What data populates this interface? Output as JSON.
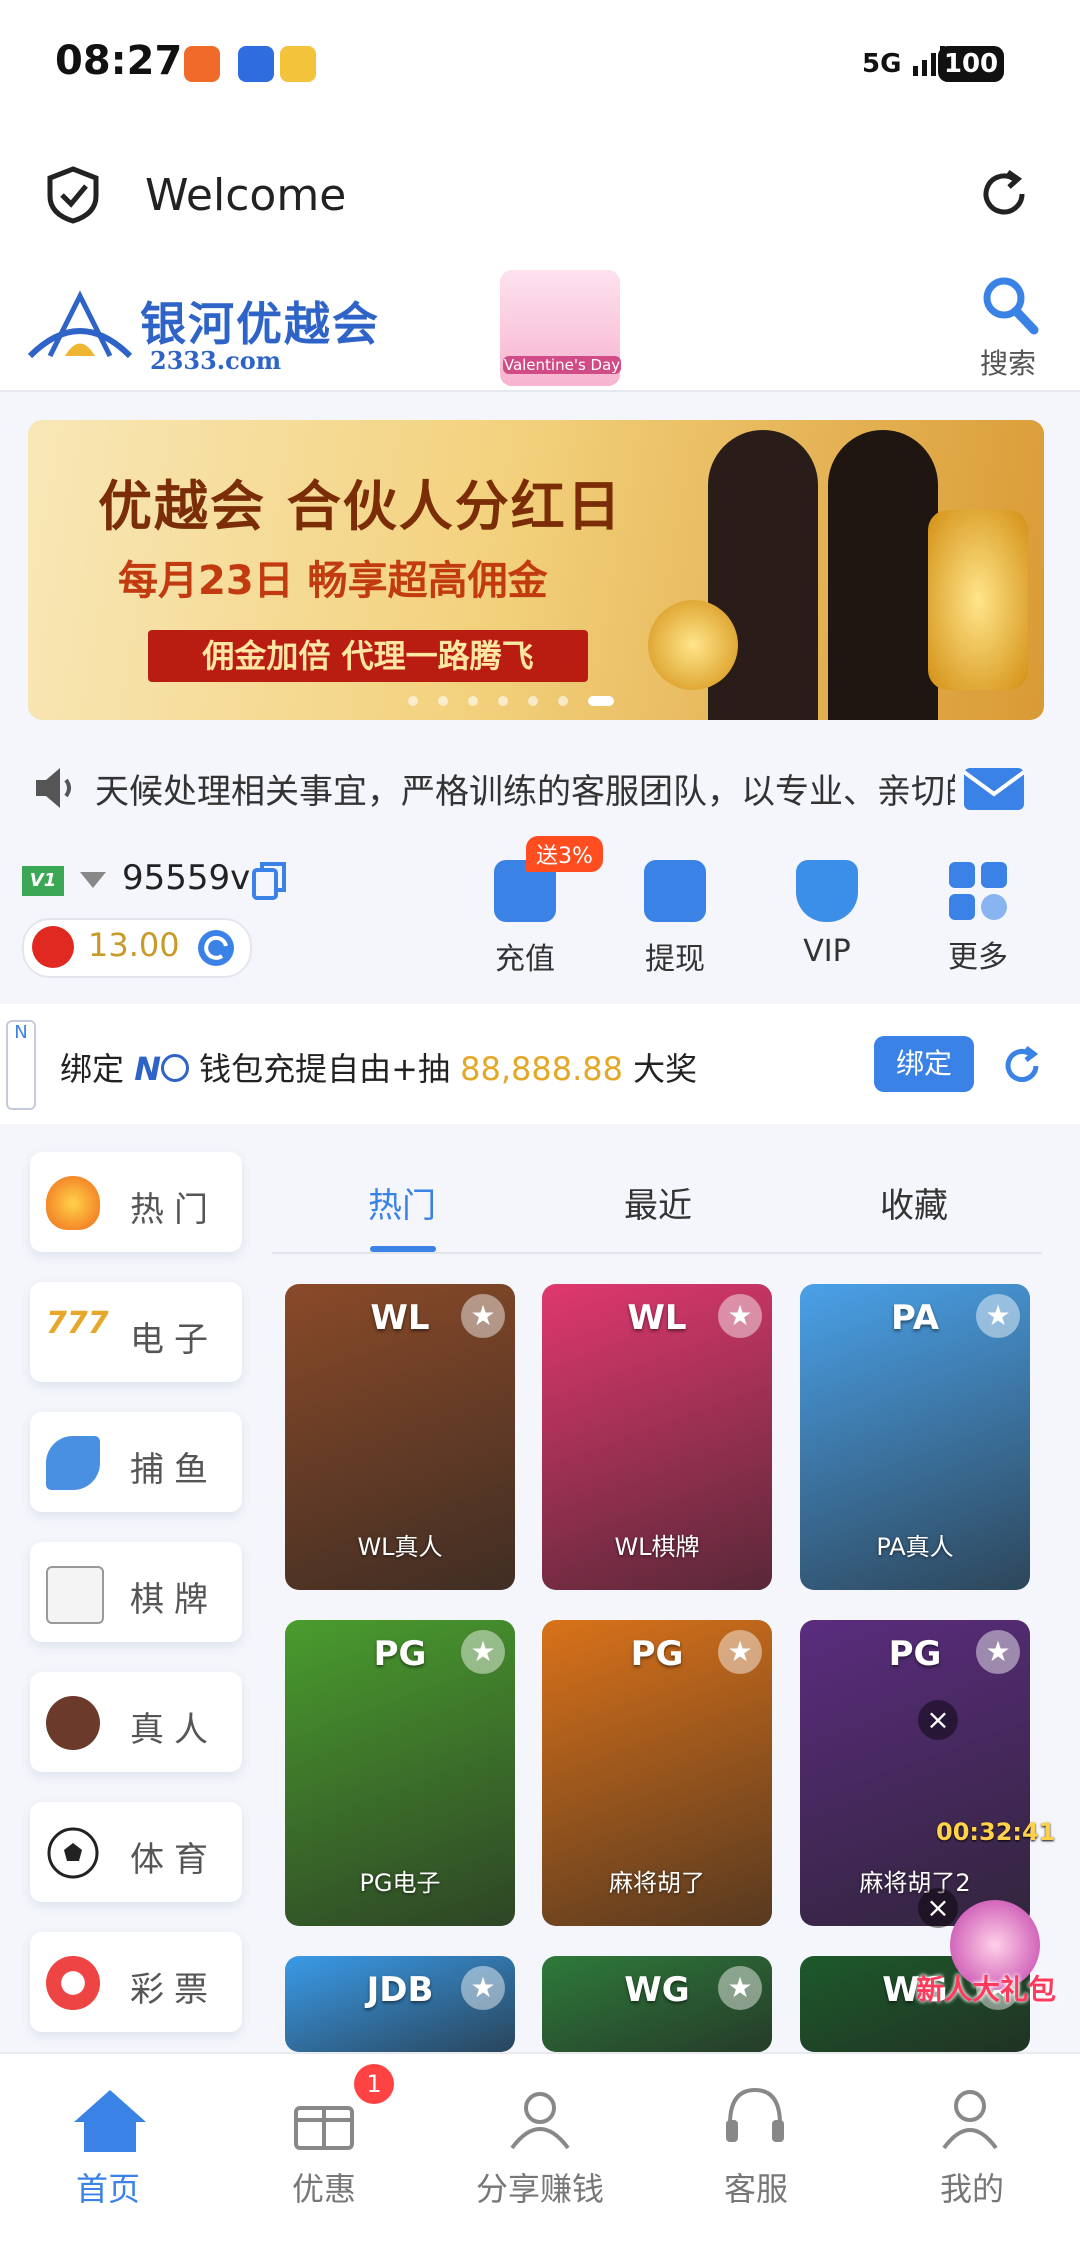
{
  "status_bar": {
    "time": "08:27",
    "signal": "5G",
    "battery": "100"
  },
  "browser": {
    "title": "Welcome"
  },
  "header": {
    "logo_cn": "银河优越会",
    "logo_url": "2333.com",
    "vday_label": "Valentine's Day",
    "search_label": "搜索"
  },
  "banner": {
    "line1": "优越会 合伙人分红日",
    "line2": "每月23日 畅享超高佣金",
    "line3": "佣金加倍 代理一路腾飞"
  },
  "marquee": {
    "text": "天候处理相关事宜，严格训练的客服团队，以专业、亲切的"
  },
  "account": {
    "vip_level": "V1",
    "username": "95559v",
    "balance": "13.00"
  },
  "actions": [
    {
      "label": "充值",
      "badge": "送3%"
    },
    {
      "label": "提现"
    },
    {
      "label": "VIP"
    },
    {
      "label": "更多"
    }
  ],
  "bind": {
    "prefix": "绑定",
    "brand": "N",
    "mid": "钱包充提自由+抽",
    "amount": "88,888.88",
    "suffix": "大奖",
    "button": "绑定",
    "side": "N"
  },
  "categories": [
    "热门",
    "电子",
    "捕鱼",
    "棋牌",
    "真人",
    "体育",
    "彩票"
  ],
  "tabs": [
    "热门",
    "最近",
    "收藏"
  ],
  "games": [
    {
      "brand": "WL",
      "name": "WL真人",
      "color": "#8a4a28"
    },
    {
      "brand": "WL",
      "name": "WL棋牌",
      "color": "#e0386e"
    },
    {
      "brand": "PA",
      "name": "PA真人",
      "color": "#4aa1e8"
    },
    {
      "brand": "PG",
      "name": "PG电子",
      "color": "#4a9c2e"
    },
    {
      "brand": "PG",
      "name": "麻将胡了",
      "color": "#d9721a"
    },
    {
      "brand": "PG",
      "name": "麻将胡了2",
      "color": "#5a2c7e"
    },
    {
      "brand": "JDB",
      "name": "",
      "color": "#3a9be8"
    },
    {
      "brand": "WG",
      "name": "",
      "color": "#2e7a3a"
    },
    {
      "brand": "WG",
      "name": "",
      "color": "#1d5a2a"
    }
  ],
  "floating": {
    "timer": "00:32:41",
    "gift": "新人大礼包"
  },
  "bottom_nav": [
    {
      "label": "首页",
      "active": true
    },
    {
      "label": "优惠",
      "badge": "1"
    },
    {
      "label": "分享赚钱"
    },
    {
      "label": "客服"
    },
    {
      "label": "我的"
    }
  ],
  "colors": {
    "accent": "#3b82e6",
    "gold": "#c89a28",
    "promo": "#ff4d1f"
  }
}
